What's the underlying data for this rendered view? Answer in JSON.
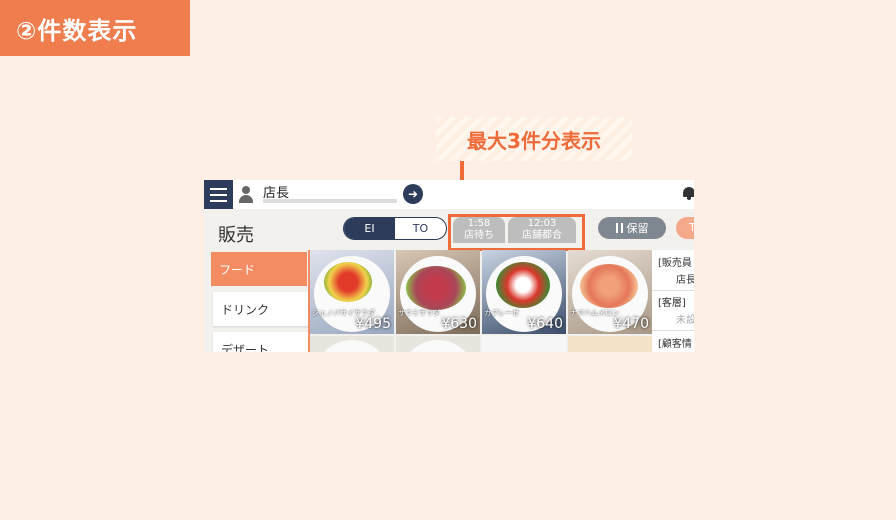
{
  "step_tag": "②件数表示",
  "callout": "最大3件分表示",
  "topbar": {
    "user_name": "店長"
  },
  "header": {
    "title": "販売",
    "toggle": {
      "eat_in": "EI",
      "take_out": "TO"
    },
    "queue": [
      {
        "time": "1:58",
        "label": "店待ち"
      },
      {
        "time": "12:03",
        "label": "店舗都合"
      }
    ],
    "hold_label": "保留",
    "next_label": "T"
  },
  "sidebar": {
    "items": [
      {
        "label": "フード",
        "active": true
      },
      {
        "label": "ドリンク",
        "active": false
      },
      {
        "label": "デザート",
        "active": false
      }
    ]
  },
  "products": [
    {
      "name": "ジェノバサイサラダ",
      "price": "¥495"
    },
    {
      "name": "サラミサラダ",
      "price": "¥630"
    },
    {
      "name": "カプレーゼ",
      "price": "¥640"
    },
    {
      "name": "ナマハムメロン",
      "price": "¥470"
    }
  ],
  "info_panel": {
    "sales_label": "[販売員",
    "sales_value": "店長",
    "tier_label": "[客層]",
    "tier_value": "未設",
    "customer_label": "[顧客情"
  },
  "colors": {
    "accent": "#ef6b3a",
    "navy": "#2d3c5a",
    "tab_orange": "#f38c63"
  }
}
